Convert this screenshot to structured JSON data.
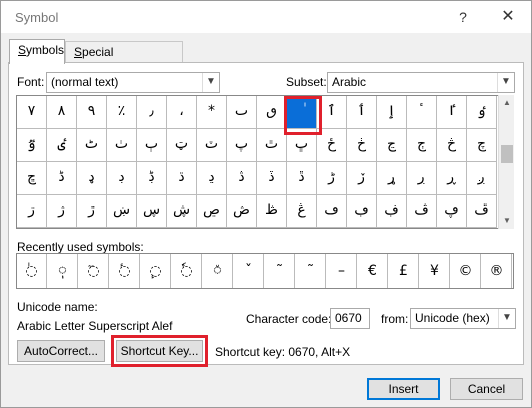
{
  "window": {
    "title": "Symbol",
    "help": "?",
    "close": "✕"
  },
  "tabs": [
    {
      "label": "Symbols"
    },
    {
      "label": "Special Characters"
    }
  ],
  "font": {
    "label": "Font:",
    "value": "(normal text)"
  },
  "subset": {
    "label": "Subset:",
    "value": "Arabic"
  },
  "symbols": [
    [
      "٧",
      "٨",
      "٩",
      "٪",
      "٫",
      "،",
      "*",
      "ٮ",
      "ٯ",
      "ٰ",
      "ٱ",
      "ٲ",
      "ٳ",
      "ٴ",
      "ٵ",
      "ٶ"
    ],
    [
      "ٷ",
      "ٸ",
      "ٹ",
      "ٺ",
      "ٻ",
      "ټ",
      "ٽ",
      "پ",
      "ٿ",
      "ڀ",
      "ځ",
      "ڂ",
      "ڃ",
      "ڄ",
      "څ",
      "چ"
    ],
    [
      "ڇ",
      "ڈ",
      "ډ",
      "ڊ",
      "ڋ",
      "ڌ",
      "ڍ",
      "ڎ",
      "ڏ",
      "ڐ",
      "ڑ",
      "ڒ",
      "ړ",
      "ڔ",
      "ڕ",
      "ږ"
    ],
    [
      "ڗ",
      "ژ",
      "ڙ",
      "ښ",
      "ڛ",
      "ڜ",
      "ڝ",
      "ڞ",
      "ڟ",
      "ڠ",
      "ڡ",
      "ڢ",
      "ڣ",
      "ڤ",
      "ڥ",
      "ڦ"
    ]
  ],
  "selected_symbol": "ٰ",
  "recent": {
    "label": "Recently used symbols:",
    "symbols": [
      "◌ٰ",
      "◌ٖ",
      "◌ٓ",
      "◌ٔ",
      "◌ٕ",
      "◌ٗ",
      "◌٘",
      "ˇ",
      "˜",
      "˜",
      "–",
      "€",
      "£",
      "¥",
      "©",
      "®"
    ]
  },
  "unicode": {
    "label": "Unicode name:",
    "name": "Arabic Letter Superscript Alef"
  },
  "char_code": {
    "label": "Character code:",
    "value": "0670"
  },
  "from": {
    "label": "from:",
    "value": "Unicode (hex)"
  },
  "buttons": {
    "autocorrect": "AutoCorrect...",
    "shortcut_key": "Shortcut Key...",
    "insert": "Insert",
    "cancel": "Cancel"
  },
  "shortcut_text": "Shortcut key: 0670, Alt+X",
  "colors": {
    "selection": "#0a6ed8",
    "highlight_outline": "#e0202c"
  }
}
